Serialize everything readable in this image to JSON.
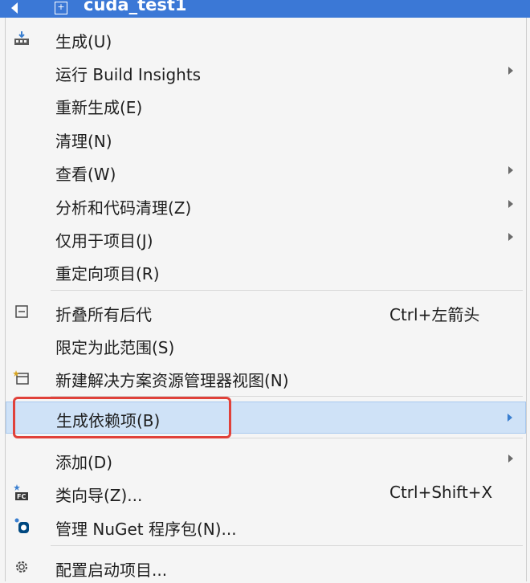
{
  "titlebar": {
    "project_name": "cuda_test1",
    "project_icon": "project-plus-icon"
  },
  "menu": {
    "items": [
      {
        "label": "生成(U)",
        "icon": "build-icon",
        "shortcut": "",
        "submenu": false
      },
      {
        "label": "运行 Build Insights",
        "icon": "",
        "shortcut": "",
        "submenu": true
      },
      {
        "label": "重新生成(E)",
        "icon": "",
        "shortcut": "",
        "submenu": false
      },
      {
        "label": "清理(N)",
        "icon": "",
        "shortcut": "",
        "submenu": false
      },
      {
        "label": "查看(W)",
        "icon": "",
        "shortcut": "",
        "submenu": true
      },
      {
        "label": "分析和代码清理(Z)",
        "icon": "",
        "shortcut": "",
        "submenu": true
      },
      {
        "label": "仅用于项目(J)",
        "icon": "",
        "shortcut": "",
        "submenu": true
      },
      {
        "label": "重定向项目(R)",
        "icon": "",
        "shortcut": "",
        "submenu": false
      },
      {
        "label": "折叠所有后代",
        "icon": "collapse-icon",
        "shortcut": "Ctrl+左箭头",
        "submenu": false
      },
      {
        "label": "限定为此范围(S)",
        "icon": "",
        "shortcut": "",
        "submenu": false
      },
      {
        "label": "新建解决方案资源管理器视图(N)",
        "icon": "new-view-icon",
        "shortcut": "",
        "submenu": false
      },
      {
        "label": "生成依赖项(B)",
        "icon": "",
        "shortcut": "",
        "submenu": true,
        "highlighted": true
      },
      {
        "label": "添加(D)",
        "icon": "",
        "shortcut": "",
        "submenu": true
      },
      {
        "label": "类向导(Z)...",
        "icon": "class-wizard-icon",
        "shortcut": "Ctrl+Shift+X",
        "submenu": false
      },
      {
        "label": "管理 NuGet 程序包(N)...",
        "icon": "nuget-icon",
        "shortcut": "",
        "submenu": false
      },
      {
        "label": "配置启动项目...",
        "icon": "gear-icon",
        "shortcut": "",
        "submenu": false
      }
    ]
  },
  "colors": {
    "titlebar_bg": "#3b78d6",
    "menu_bg": "#f5f5f5",
    "highlight_bg": "#cfe2f7",
    "annotation_red": "#e0413a"
  }
}
